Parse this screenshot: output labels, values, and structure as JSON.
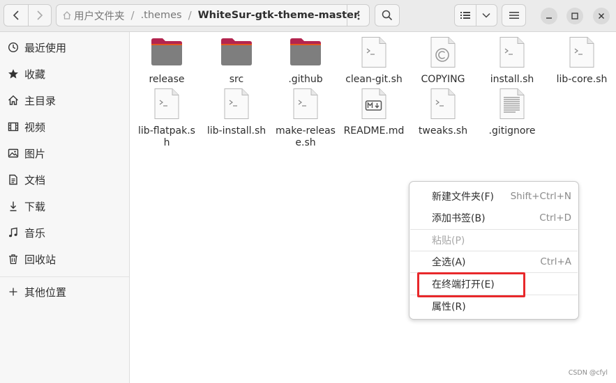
{
  "window": {
    "path": [
      "用户文件夹",
      ".themes",
      "WhiteSur-gtk-theme-master"
    ],
    "colors": {
      "header": "#ebebeb",
      "sidebar": "#f7f7f7",
      "highlight": "#e8282b",
      "folder": "#7e7e7e",
      "folder_tab": "#b3254f"
    }
  },
  "sidebar": {
    "items": [
      {
        "label": "最近使用",
        "icon": "clock-icon"
      },
      {
        "label": "收藏",
        "icon": "star-icon"
      },
      {
        "label": "主目录",
        "icon": "home-icon"
      },
      {
        "label": "视频",
        "icon": "film-icon"
      },
      {
        "label": "图片",
        "icon": "image-icon"
      },
      {
        "label": "文档",
        "icon": "document-icon"
      },
      {
        "label": "下载",
        "icon": "download-icon"
      },
      {
        "label": "音乐",
        "icon": "music-icon"
      },
      {
        "label": "回收站",
        "icon": "trash-icon"
      }
    ],
    "other_locations": {
      "label": "其他位置",
      "icon": "plus-icon"
    }
  },
  "files": [
    {
      "name": "release",
      "kind": "folder"
    },
    {
      "name": "src",
      "kind": "folder"
    },
    {
      "name": ".github",
      "kind": "folder"
    },
    {
      "name": "clean-git.sh",
      "kind": "script"
    },
    {
      "name": "COPYING",
      "kind": "license"
    },
    {
      "name": "install.sh",
      "kind": "script"
    },
    {
      "name": "lib-core.sh",
      "kind": "script"
    },
    {
      "name": "lib-flatpak.sh",
      "kind": "script"
    },
    {
      "name": "lib-install.sh",
      "kind": "script"
    },
    {
      "name": "make-release.sh",
      "kind": "script"
    },
    {
      "name": "README.md",
      "kind": "markdown"
    },
    {
      "name": "tweaks.sh",
      "kind": "script"
    },
    {
      "name": ".gitignore",
      "kind": "text"
    }
  ],
  "context_menu": {
    "items": [
      {
        "label": "新建文件夹(F)",
        "accel": "Shift+Ctrl+N",
        "enabled": true
      },
      {
        "label": "添加书签(B)",
        "accel": "Ctrl+D",
        "enabled": true
      },
      {
        "label": "粘贴(P)",
        "accel": "",
        "enabled": false
      },
      {
        "label": "全选(A)",
        "accel": "Ctrl+A",
        "enabled": true
      },
      {
        "label": "在终端打开(E)",
        "accel": "",
        "enabled": true
      },
      {
        "label": "属性(R)",
        "accel": "",
        "enabled": true
      }
    ]
  },
  "watermark": "CSDN @cfyl"
}
